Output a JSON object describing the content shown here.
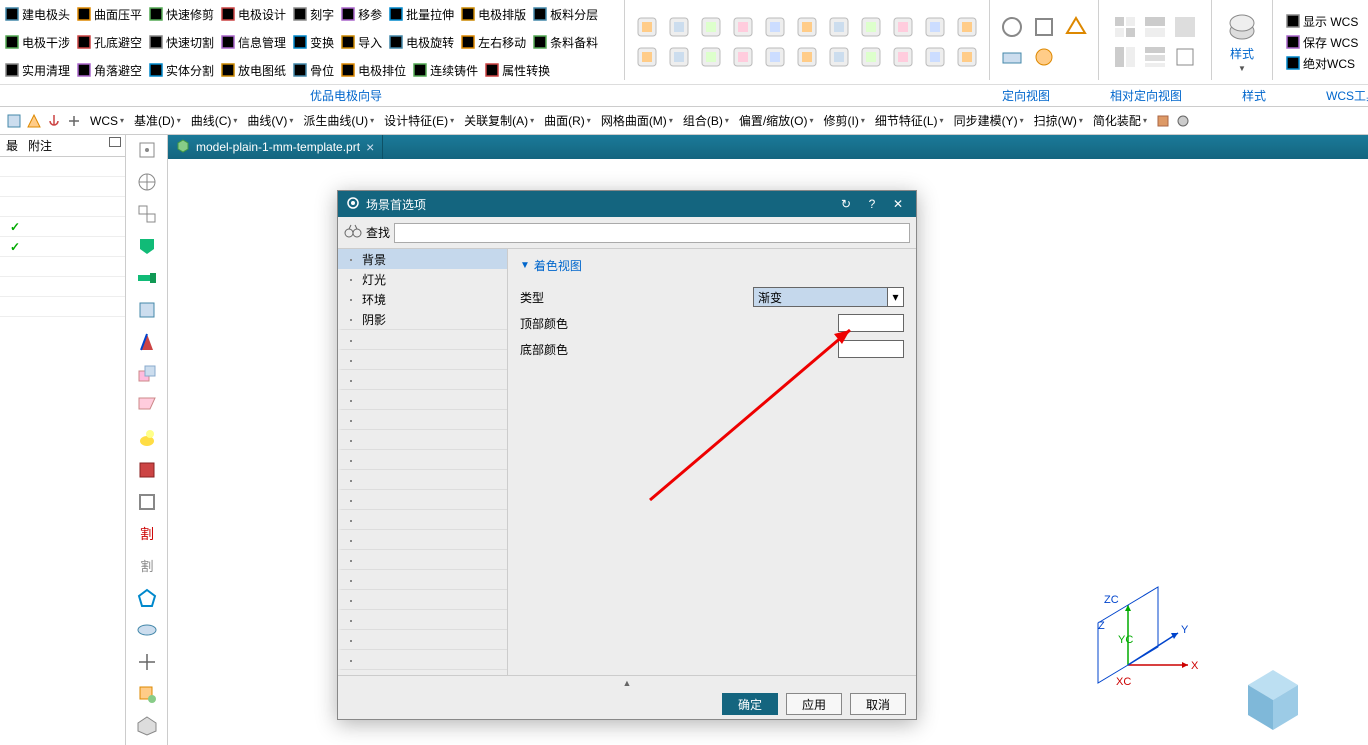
{
  "ribbon": {
    "row1": [
      {
        "label": "建电极头"
      },
      {
        "label": "曲面压平"
      },
      {
        "label": "快速修剪"
      },
      {
        "label": "电极设计"
      },
      {
        "label": "刻字"
      },
      {
        "label": "移参"
      },
      {
        "label": "批量拉伸"
      },
      {
        "label": "电极排版"
      },
      {
        "label": "板料分层"
      }
    ],
    "row2": [
      {
        "label": "电极干涉"
      },
      {
        "label": "孔底避空"
      },
      {
        "label": "快速切割"
      },
      {
        "label": "信息管理"
      },
      {
        "label": "变换"
      },
      {
        "label": "导入"
      },
      {
        "label": "电极旋转"
      },
      {
        "label": "左右移动"
      },
      {
        "label": "条料备料"
      }
    ],
    "row3": [
      {
        "label": "实用清理"
      },
      {
        "label": "角落避空"
      },
      {
        "label": "实体分割"
      },
      {
        "label": "放电图纸"
      },
      {
        "label": "骨位"
      },
      {
        "label": "电极排位"
      },
      {
        "label": "连续铸件"
      },
      {
        "label": "属性转换"
      }
    ],
    "labels": [
      "优品电极向导",
      "定向视图",
      "相对定向视图",
      "样式",
      "WCS工具"
    ],
    "right": [
      {
        "label": "显示 WCS"
      },
      {
        "label": "保存 WCS"
      },
      {
        "label": "绝对WCS"
      }
    ],
    "style_label": "样式"
  },
  "menubar": [
    "WCS",
    "基准(D)",
    "曲线(C)",
    "曲线(V)",
    "派生曲线(U)",
    "设计特征(E)",
    "关联复制(A)",
    "曲面(R)",
    "网格曲面(M)",
    "组合(B)",
    "偏置/缩放(O)",
    "修剪(I)",
    "细节特征(L)",
    "同步建模(Y)",
    "扫掠(W)",
    "简化装配"
  ],
  "left_panel": {
    "col1": "最",
    "col2": "附注"
  },
  "tab": {
    "name": "model-plain-1-mm-template.prt"
  },
  "dialog": {
    "title": "场景首选项",
    "search_label": "查找",
    "nav": [
      "背景",
      "灯光",
      "环境",
      "阴影"
    ],
    "section": "着色视图",
    "rows": {
      "type_label": "类型",
      "type_value": "渐变",
      "top_color": "顶部颜色",
      "bottom_color": "底部颜色"
    },
    "buttons": {
      "ok": "确定",
      "apply": "应用",
      "cancel": "取消"
    }
  },
  "triad": {
    "x": "X",
    "y": "Y",
    "z": "Z",
    "xc": "XC",
    "yc": "YC",
    "zc": "ZC"
  }
}
